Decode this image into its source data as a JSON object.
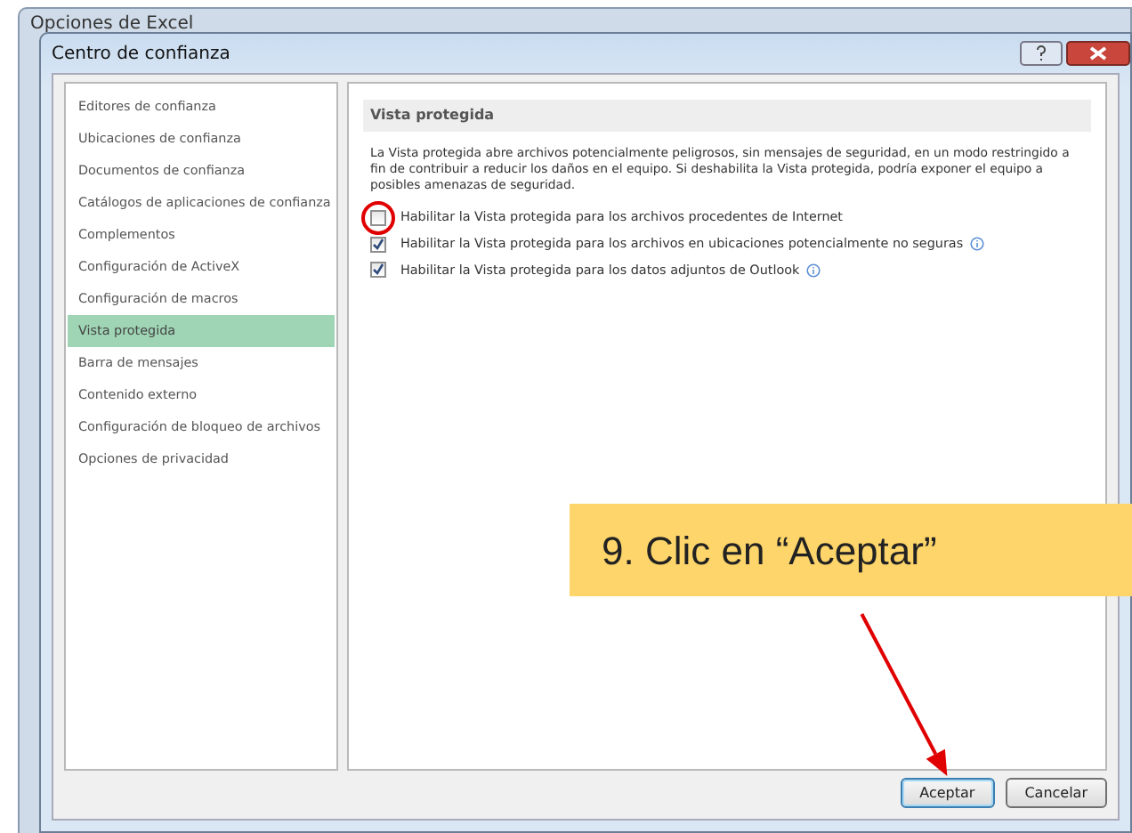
{
  "back_window": {
    "title": "Opciones de Excel"
  },
  "dialog": {
    "title": "Centro de confianza"
  },
  "sidebar": {
    "items": [
      {
        "label": "Editores de confianza",
        "selected": false
      },
      {
        "label": "Ubicaciones de confianza",
        "selected": false
      },
      {
        "label": "Documentos de confianza",
        "selected": false
      },
      {
        "label": "Catálogos de aplicaciones de confianza",
        "selected": false
      },
      {
        "label": "Complementos",
        "selected": false
      },
      {
        "label": "Configuración de ActiveX",
        "selected": false
      },
      {
        "label": "Configuración de macros",
        "selected": false
      },
      {
        "label": "Vista protegida",
        "selected": true
      },
      {
        "label": "Barra de mensajes",
        "selected": false
      },
      {
        "label": "Contenido externo",
        "selected": false
      },
      {
        "label": "Configuración de bloqueo de archivos",
        "selected": false
      },
      {
        "label": "Opciones de privacidad",
        "selected": false
      }
    ]
  },
  "section": {
    "heading": "Vista protegida",
    "description": "La Vista protegida abre archivos potencialmente peligrosos, sin mensajes de seguridad, en un modo restringido a fin de contribuir a reducir los daños en el equipo. Si deshabilita la Vista protegida, podría exponer el equipo a posibles amenazas de seguridad.",
    "options": [
      {
        "label": "Habilitar la Vista protegida para los archivos procedentes de Internet",
        "checked": false,
        "info": false,
        "circled": true
      },
      {
        "label": "Habilitar la Vista protegida para los archivos en ubicaciones potencialmente no seguras",
        "checked": true,
        "info": true,
        "circled": false
      },
      {
        "label": "Habilitar la Vista protegida para los datos adjuntos de Outlook",
        "checked": true,
        "info": true,
        "circled": false
      }
    ]
  },
  "buttons": [
    {
      "label": "Aceptar",
      "default": true
    },
    {
      "label": "Cancelar",
      "default": false
    }
  ],
  "annotation": {
    "callout": "9. Clic en “Aceptar”"
  }
}
